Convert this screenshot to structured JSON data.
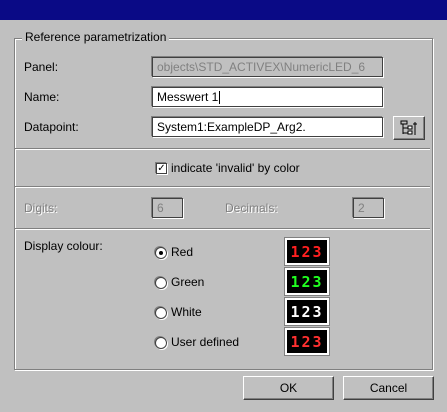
{
  "group": {
    "title": "Reference parametrization"
  },
  "panel": {
    "label": "Panel:",
    "value": "objects\\STD_ACTIVEX\\NumericLED_6"
  },
  "name": {
    "label": "Name:",
    "value": "Messwert 1"
  },
  "datapoint": {
    "label": "Datapoint:",
    "value": "System1:ExampleDP_Arg2."
  },
  "invalid": {
    "label": "indicate 'invalid' by color",
    "checked": true
  },
  "digits": {
    "label": "Digits:",
    "value": "6"
  },
  "decimals": {
    "label": "Decimals:",
    "value": "2"
  },
  "display_colour": {
    "label": "Display colour:",
    "options": [
      {
        "label": "Red",
        "checked": true,
        "led_text": "123",
        "color": "#ff2020"
      },
      {
        "label": "Green",
        "checked": false,
        "led_text": "123",
        "color": "#20ff20"
      },
      {
        "label": "White",
        "checked": false,
        "led_text": "123",
        "color": "#ffffff"
      },
      {
        "label": "User defined",
        "checked": false,
        "led_text": "123",
        "color": "#ff3030"
      }
    ]
  },
  "buttons": {
    "ok": "OK",
    "cancel": "Cancel"
  },
  "colors": {
    "titlebar": "#0a0a86",
    "face": "#c0c0c0"
  }
}
